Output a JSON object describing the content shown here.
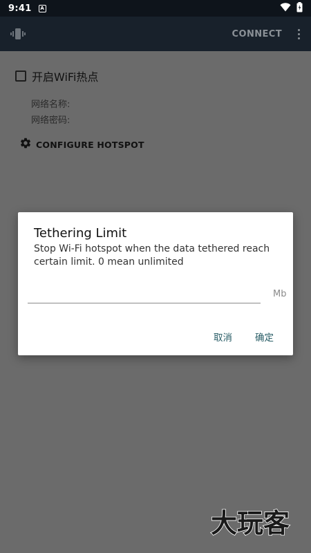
{
  "status_bar": {
    "time": "9:41",
    "notification_icon": "A"
  },
  "app_bar": {
    "connect_label": "CONNECT"
  },
  "main": {
    "hotspot_checkbox_label": "开启WiFi热点",
    "network_name_label": "网络名称:",
    "network_password_label": "网络密码:",
    "configure_label": "CONFIGURE HOTSPOT"
  },
  "dialog": {
    "title": "Tethering Limit",
    "message": "Stop Wi-Fi hotspot when the data tethered reach certain limit. 0 mean unlimited",
    "input_value": "",
    "unit": "Mb",
    "cancel_label": "取消",
    "ok_label": "确定"
  },
  "watermark": {
    "text": "大玩客"
  },
  "colors": {
    "accent": "#2a5e67",
    "app_bar": "#18212b",
    "status_bar": "#0e141b",
    "scrim": "#6b6b6b"
  }
}
